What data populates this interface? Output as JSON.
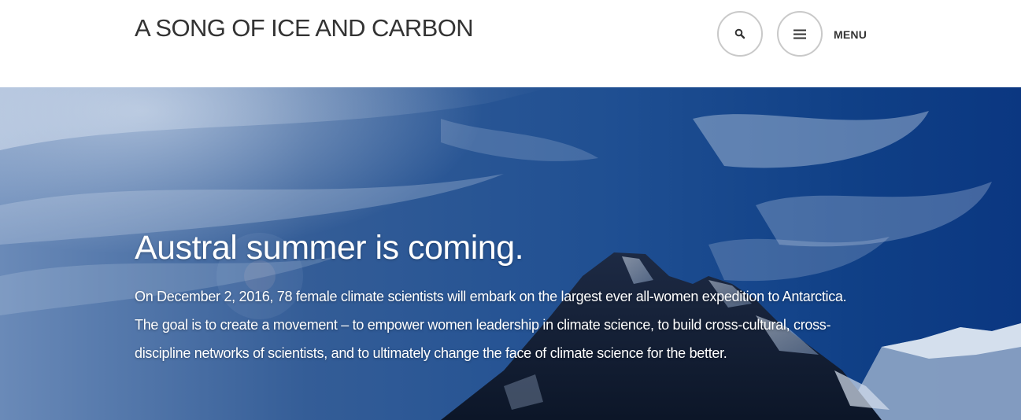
{
  "header": {
    "site_title": "A SONG OF ICE AND CARBON",
    "search_icon": "search-icon",
    "menu_icon": "hamburger-menu-icon",
    "menu_label": "MENU"
  },
  "hero": {
    "headline": "Austral summer is coming.",
    "body": "On December 2, 2016, 78 female climate scientists will embark on the largest ever all-women expedition to Antarctica. The goal is to create a movement – to empower women leadership in climate science, to build cross-cultural, cross-discipline networks of scientists, and to ultimately change the face of climate science for the better."
  },
  "colors": {
    "header_bg": "#ffffff",
    "title_text": "#333333",
    "button_border": "#c9c9c9",
    "sky_blue": "#1f4f92",
    "hero_text": "#ffffff"
  }
}
